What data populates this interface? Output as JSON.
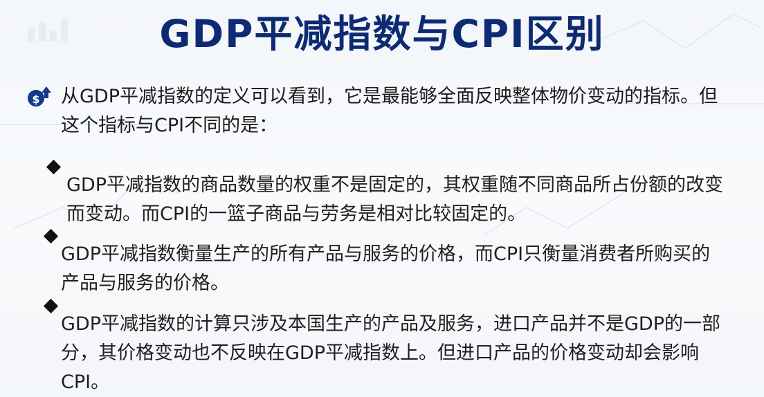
{
  "title": "GDP平减指数与CPI区别",
  "intro": "从GDP平减指数的定义可以看到，它是最能够全面反映整体物价变动的指标。但这个指标与CPI不同的是：",
  "bullets": [
    "GDP平减指数的商品数量的权重不是固定的，其权重随不同商品所占份额的改变而变动。而CPI的一篮子商品与劳务是相对比较固定的。",
    "GDP平减指数衡量生产的所有产品与服务的价格，而CPI只衡量消费者所购买的产品与服务的价格。",
    "GDP平减指数的计算只涉及本国生产的产品及服务，进口产品并不是GDP的一部分，其价格变动也不反映在GDP平减指数上。但进口产品的价格变动却会影响CPI。"
  ],
  "icons": {
    "intro": "dollar-coin-up-arrow-icon",
    "bullet": "diamond-bullet-icon"
  },
  "colors": {
    "title": "#0e2a73",
    "icon": "#123a8c",
    "text": "#1b1b1b"
  }
}
